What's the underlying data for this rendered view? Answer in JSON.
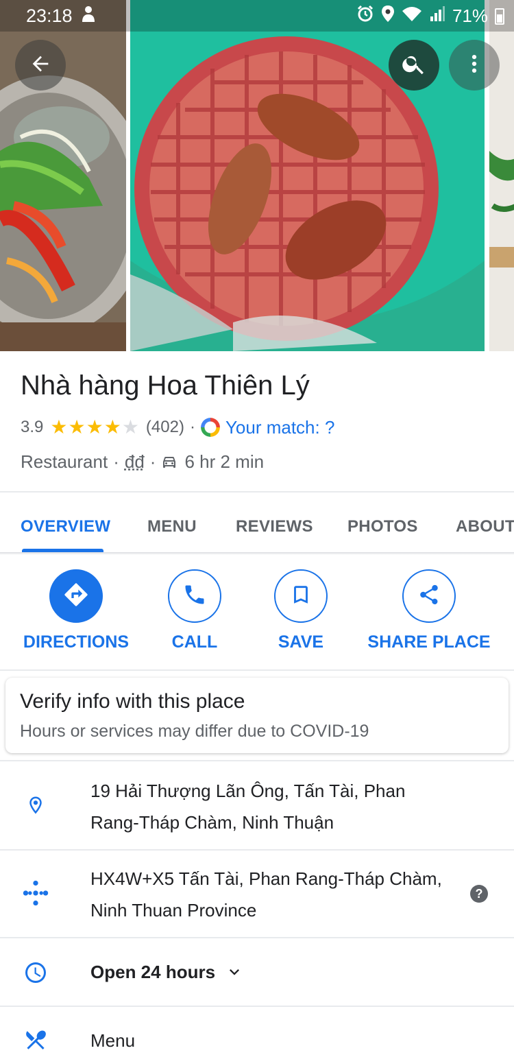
{
  "status_bar": {
    "time": "23:18",
    "battery": "71%"
  },
  "place": {
    "name": "Nhà hàng Hoa Thiên Lý",
    "rating": "3.9",
    "rating_value": 3.9,
    "review_count": "(402)",
    "separator": "·",
    "match_label": "Your match: ?",
    "category": "Restaurant",
    "price": "đđ",
    "drive_time": "6 hr 2 min"
  },
  "tabs": [
    {
      "label": "OVERVIEW",
      "active": true
    },
    {
      "label": "MENU",
      "active": false
    },
    {
      "label": "REVIEWS",
      "active": false
    },
    {
      "label": "PHOTOS",
      "active": false
    },
    {
      "label": "ABOUT",
      "active": false
    }
  ],
  "actions": {
    "directions": "DIRECTIONS",
    "call": "CALL",
    "save": "SAVE",
    "share": "SHARE PLACE"
  },
  "covid_card": {
    "title": "Verify info with this place",
    "subtitle": "Hours or services may differ due to COVID-19"
  },
  "info": {
    "address_line1": "19 Hải Thượng Lãn Ông, Tấn Tài, Phan",
    "address_line2": "Rang-Tháp Chàm, Ninh Thuận",
    "plus_code_line1": "HX4W+X5 Tấn Tài, Phan Rang-Tháp Chàm,",
    "plus_code_line2": "Ninh Thuan Province",
    "hours": "Open 24 hours",
    "menu": "Menu",
    "help_glyph": "?"
  },
  "colors": {
    "accent": "#1a73e8",
    "star": "#fbbc04",
    "text_secondary": "#5f6368"
  },
  "icons": {
    "back": "arrow-left-icon",
    "search": "search-icon",
    "more": "more-vert-icon",
    "directions": "directions-icon",
    "call": "phone-icon",
    "save": "bookmark-icon",
    "share": "share-icon",
    "address": "location-pin-icon",
    "plus_code": "plus-code-icon",
    "hours": "clock-icon",
    "menu": "restaurant-icon"
  }
}
